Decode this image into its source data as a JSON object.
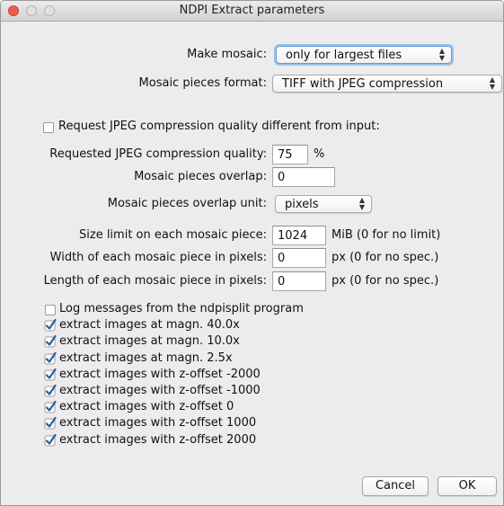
{
  "window": {
    "title": "NDPI Extract parameters"
  },
  "form": {
    "make_mosaic": {
      "label": "Make mosaic:",
      "value": "only for largest files"
    },
    "pieces_format": {
      "label": "Mosaic pieces format:",
      "value": "TIFF with JPEG compression"
    },
    "request_quality": {
      "label": "Request JPEG compression quality different from input:",
      "checked": false
    },
    "jpeg_quality": {
      "label": "Requested JPEG compression quality:",
      "value": "75",
      "unit": "%"
    },
    "overlap": {
      "label": "Mosaic pieces overlap:",
      "value": "0"
    },
    "overlap_unit": {
      "label": "Mosaic pieces overlap unit:",
      "value": "pixels"
    },
    "size_limit": {
      "label": "Size limit on each mosaic piece:",
      "value": "1024",
      "hint": "MiB (0 for no limit)"
    },
    "width": {
      "label": "Width of each mosaic piece in pixels:",
      "value": "0",
      "hint": "px (0 for no spec.)"
    },
    "length": {
      "label": "Length of each mosaic piece in pixels:",
      "value": "0",
      "hint": "px (0 for no spec.)"
    }
  },
  "checkboxes": [
    {
      "label": "Log messages from the ndpisplit program",
      "checked": false
    },
    {
      "label": "extract images at magn. 40.0x",
      "checked": true
    },
    {
      "label": "extract images at magn. 10.0x",
      "checked": true
    },
    {
      "label": "extract images at magn. 2.5x",
      "checked": true
    },
    {
      "label": "extract images with z-offset -2000",
      "checked": true
    },
    {
      "label": "extract images with z-offset -1000",
      "checked": true
    },
    {
      "label": "extract images with z-offset 0",
      "checked": true
    },
    {
      "label": "extract images with z-offset 1000",
      "checked": true
    },
    {
      "label": "extract images with z-offset 2000",
      "checked": true
    }
  ],
  "buttons": {
    "cancel": "Cancel",
    "ok": "OK"
  },
  "icons": {
    "popup_arrows": "⇕",
    "checkmark": "checkmark-icon"
  },
  "colors": {
    "close": "#ee5b54",
    "focus": "#5b9bd5",
    "checkmark": "#2a5d9f"
  }
}
